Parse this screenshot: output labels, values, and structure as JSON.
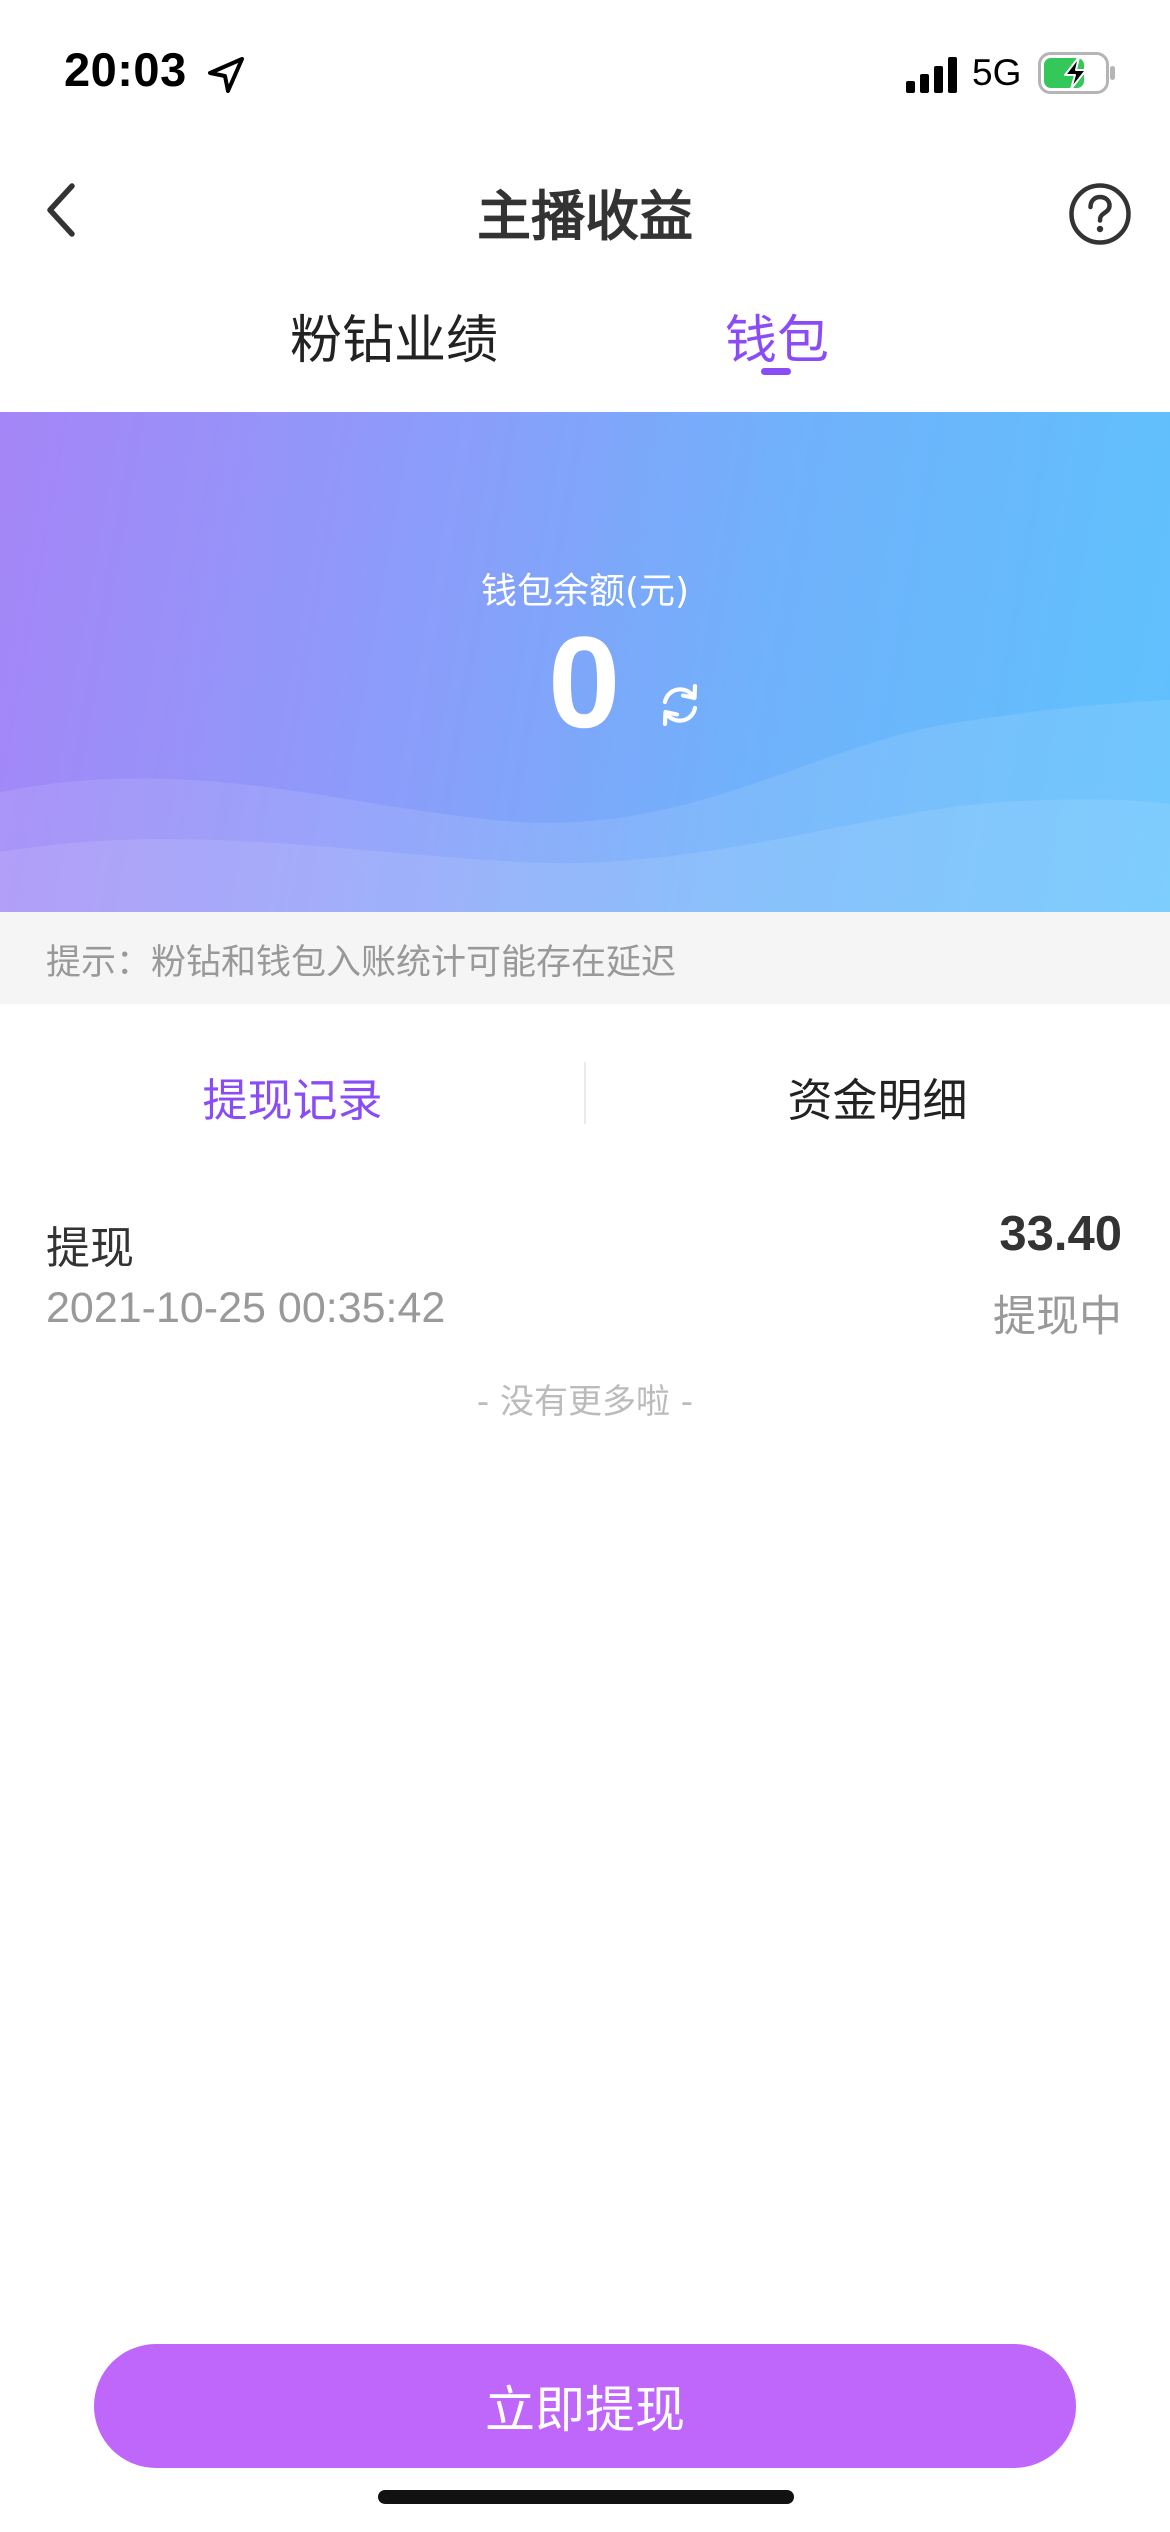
{
  "status_bar": {
    "time": "20:03",
    "network": "5G",
    "icons": [
      "location-arrow-icon",
      "signal-bars-icon",
      "battery-charging-icon"
    ],
    "battery_color": "#34c759"
  },
  "header": {
    "title": "主播收益",
    "back_icon": "chevron-left-icon",
    "help_icon": "question-circle-icon"
  },
  "tabs": [
    {
      "label": "粉钻业绩",
      "active": false
    },
    {
      "label": "钱包",
      "active": true
    }
  ],
  "balance": {
    "label": "钱包余额(元)",
    "value": "0",
    "refresh_icon": "refresh-icon"
  },
  "hint": "提示：粉钻和钱包入账统计可能存在延迟",
  "sub_tabs": [
    {
      "label": "提现记录",
      "active": true
    },
    {
      "label": "资金明细",
      "active": false
    }
  ],
  "records": [
    {
      "type": "提现",
      "amount": "33.40",
      "time": "2021-10-25 00:35:42",
      "status": "提现中"
    }
  ],
  "end_text": "- 没有更多啦 -",
  "withdraw_button": "立即提现",
  "colors": {
    "accent": "#8a4cf5",
    "button": "#c067fb",
    "card_gradient_start": "#a585f7",
    "card_gradient_end": "#5fc2fd"
  }
}
